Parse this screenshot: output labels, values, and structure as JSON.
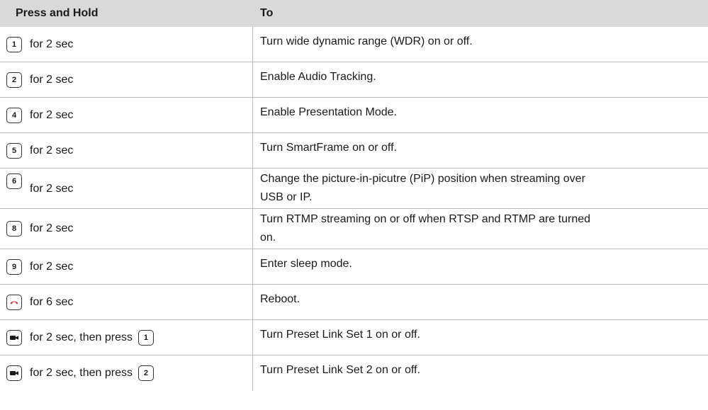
{
  "header": {
    "col1": "Press and Hold",
    "col2": "To"
  },
  "rows": [
    {
      "key": "1",
      "key_icon": "key-1",
      "suffix": "for 2 sec",
      "action": "Turn wide dynamic range (WDR) on or off."
    },
    {
      "key": "2",
      "key_icon": "key-2",
      "suffix": "for 2 sec",
      "action": "Enable Audio Tracking."
    },
    {
      "key": "4",
      "key_icon": "key-4",
      "suffix": "for 2 sec",
      "action": "Enable Presentation Mode."
    },
    {
      "key": "5",
      "key_icon": "key-5",
      "suffix": "for 2 sec",
      "action": "Turn SmartFrame on or off."
    },
    {
      "key": "6",
      "key_icon": "key-6",
      "suffix": "for 2 sec",
      "action_line1": "Change the picture-in-picutre (PiP) position when streaming over",
      "action_line2": "USB or IP."
    },
    {
      "key": "8",
      "key_icon": "key-8",
      "suffix": "for 2 sec",
      "action_line1": "Turn RTMP streaming on or off when RTSP and RTMP are turned",
      "action_line2": "on."
    },
    {
      "key": "9",
      "key_icon": "key-9",
      "suffix": "for 2 sec",
      "action": "Enter sleep mode."
    },
    {
      "key_icon": "hang-up-icon",
      "key_color": "#d0312d",
      "suffix": "for 6 sec",
      "action": "Reboot."
    },
    {
      "key_icon": "camera-icon",
      "suffix": "for 2 sec, then press",
      "key2": "1",
      "action": "Turn Preset Link Set 1 on or off."
    },
    {
      "key_icon": "camera-icon",
      "suffix": "for 2 sec, then press",
      "key2": "2",
      "action": "Turn Preset Link Set 2 on or off."
    }
  ]
}
